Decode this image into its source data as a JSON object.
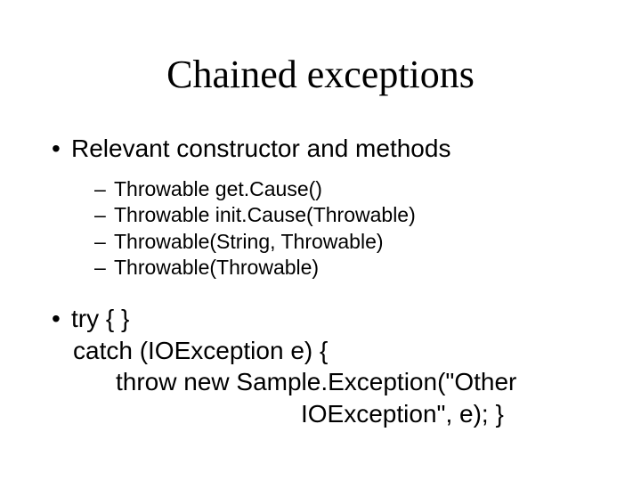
{
  "title": "Chained exceptions",
  "bullets": {
    "b1": "Relevant constructor and methods",
    "sub": {
      "s1": "Throwable get.Cause()",
      "s2": "Throwable init.Cause(Throwable)",
      "s3": "Throwable(String, Throwable)",
      "s4": "Throwable(Throwable)"
    },
    "b2": {
      "line1": "try { }",
      "line2": "catch (IOException e) {",
      "line3": "throw new Sample.Exception(\"Other",
      "line4": "IOException\", e); }"
    }
  },
  "markers": {
    "dot": "•",
    "dash": "–"
  }
}
